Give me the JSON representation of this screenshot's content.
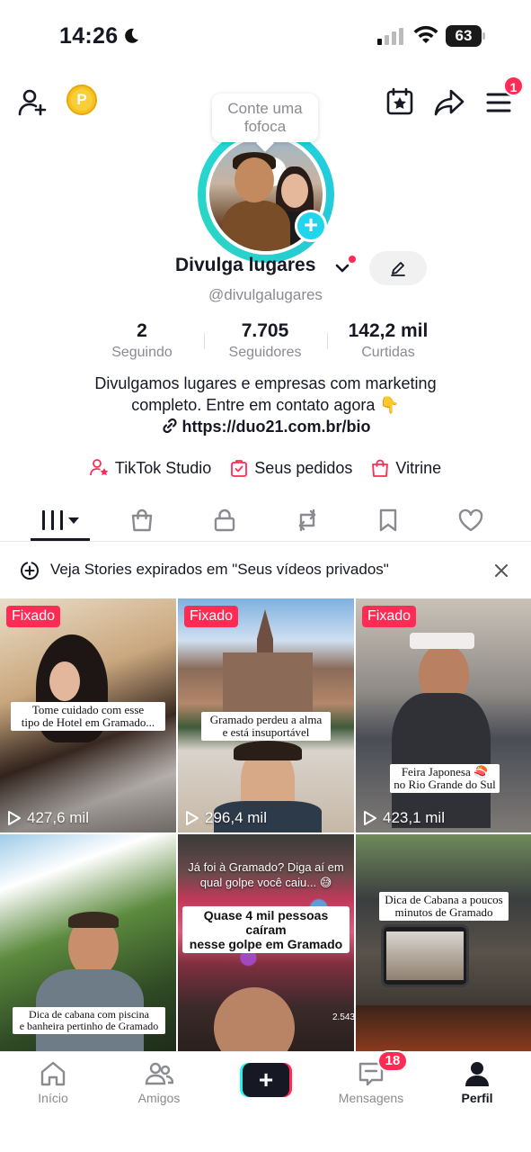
{
  "status_bar": {
    "time": "14:26",
    "battery": "63"
  },
  "header": {
    "menu_badge": "1",
    "story_bubble": "Conte uma fofoca"
  },
  "profile": {
    "name": "Divulga lugares",
    "handle": "@divulgalugares",
    "stats": [
      {
        "value": "2",
        "label": "Seguindo"
      },
      {
        "value": "7.705",
        "label": "Seguidores"
      },
      {
        "value": "142,2 mil",
        "label": "Curtidas"
      }
    ],
    "bio_line1": "Divulgamos lugares e empresas com marketing",
    "bio_line2": "completo. Entre em contato agora 👇",
    "link": "https://duo21.com.br/bio"
  },
  "shortcuts": [
    {
      "label": "TikTok Studio",
      "icon": "creator-star-icon"
    },
    {
      "label": "Seus pedidos",
      "icon": "orders-bag-icon"
    },
    {
      "label": "Vitrine",
      "icon": "showcase-bag-icon"
    }
  ],
  "tabs": [
    "videos-grid-icon",
    "shop-bag-icon",
    "lock-icon",
    "repost-icon",
    "bookmark-icon",
    "heart-icon"
  ],
  "notice": {
    "text": "Veja Stories expirados em \"Seus vídeos privados\""
  },
  "videos": [
    {
      "pinned": "Fixado",
      "caption": "Tome cuidado com esse\ntipo de Hotel em Gramado...",
      "views": "427,6 mil"
    },
    {
      "pinned": "Fixado",
      "caption": "Gramado perdeu a alma\ne está insuportável",
      "views": "296,4 mil"
    },
    {
      "pinned": "Fixado",
      "caption": "Feira Japonesa 🍣\nno Rio Grande do Sul",
      "views": "423,1 mil"
    },
    {
      "caption": "Dica de cabana com piscina\ne banheira pertinho de Gramado"
    },
    {
      "caption_top": "Já foi à Gramado? Diga aí em\nqual golpe você caiu... 😅",
      "caption": "Quase 4 mil pessoas caíram\nnesse golpe em Gramado",
      "side_count": "2.543"
    },
    {
      "caption": "Dica de Cabana a poucos\nminutos de Gramado"
    }
  ],
  "bottom_nav": {
    "items": [
      {
        "label": "Início",
        "icon": "home-icon"
      },
      {
        "label": "Amigos",
        "icon": "friends-icon"
      },
      {
        "label": "",
        "icon": "create-plus-icon"
      },
      {
        "label": "Mensagens",
        "icon": "inbox-icon",
        "badge": "18"
      },
      {
        "label": "Perfil",
        "icon": "profile-icon"
      }
    ]
  },
  "colors": {
    "accent": "#fe2c55",
    "cyan": "#25f4ee",
    "ring": "#20d5ec",
    "text": "#161823",
    "muted": "#8a8b91"
  }
}
